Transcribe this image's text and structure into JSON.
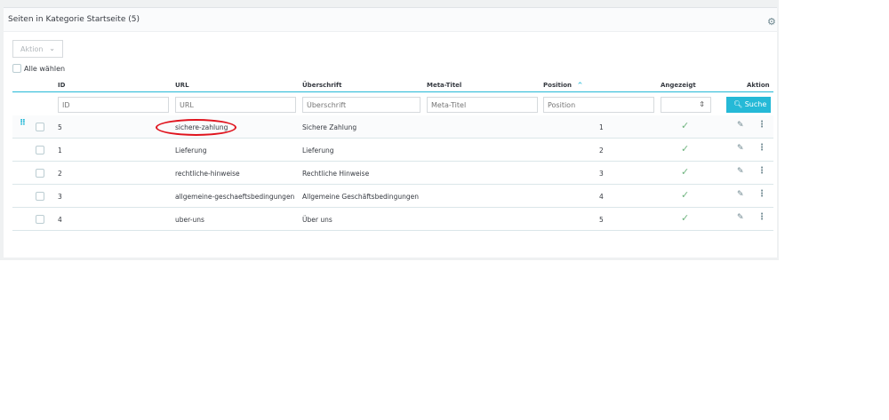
{
  "panel": {
    "title": "Seiten in Kategorie Startseite (5)"
  },
  "bulk": {
    "label": "Aktion",
    "select_all": "Alle wählen"
  },
  "columns": {
    "id": "ID",
    "url": "URL",
    "heading": "Überschrift",
    "meta": "Meta-Titel",
    "position": "Position",
    "shown": "Angezeigt",
    "action": "Aktion"
  },
  "filters": {
    "id": "ID",
    "url": "URL",
    "heading": "Überschrift",
    "meta": "Meta-Titel",
    "position": "Position",
    "search": "Suche"
  },
  "rows": [
    {
      "id": "5",
      "url": "sichere-zahlung",
      "heading": "Sichere Zahlung",
      "meta": "",
      "position": "1",
      "shown": true
    },
    {
      "id": "1",
      "url": "Lieferung",
      "heading": "Lieferung",
      "meta": "",
      "position": "2",
      "shown": true
    },
    {
      "id": "2",
      "url": "rechtliche-hinweise",
      "heading": "Rechtliche Hinweise",
      "meta": "",
      "position": "3",
      "shown": true
    },
    {
      "id": "3",
      "url": "allgemeine-geschaeftsbedingungen",
      "heading": "Allgemeine Geschäftsbedingungen",
      "meta": "",
      "position": "4",
      "shown": true
    },
    {
      "id": "4",
      "url": "uber-uns",
      "heading": "Über uns",
      "meta": "",
      "position": "5",
      "shown": true
    }
  ],
  "colors": {
    "accent": "#25b9d7",
    "check": "#70b580",
    "annotation": "#e0141e"
  }
}
